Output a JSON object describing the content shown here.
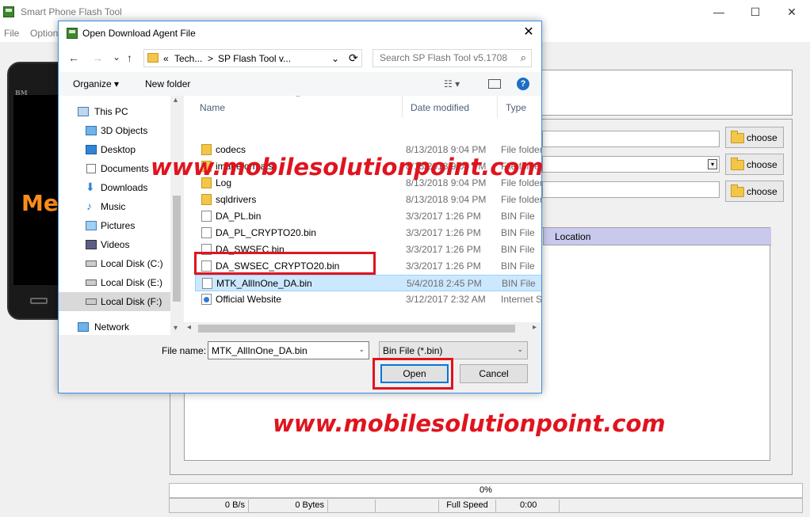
{
  "main": {
    "title": "Smart Phone Flash Tool",
    "window_controls": [
      "—",
      "☐",
      "✕"
    ],
    "menu": [
      "File",
      "Option"
    ],
    "phone_brand": "BM",
    "phone_logo": "Me",
    "choose_label": "choose",
    "table_header_location": "Location",
    "status": {
      "progress": "0%",
      "speed": "0 B/s",
      "bytes": "0 Bytes",
      "mode": "Full Speed",
      "time": "0:00"
    }
  },
  "watermark": "www.mobilesolutionpoint.com",
  "dialog": {
    "title": "Open Download Agent File",
    "close_glyph": "✕",
    "address": {
      "prefix": "«",
      "seg1": "Tech...",
      "sep": ">",
      "seg2": "SP Flash Tool v...",
      "dropdown": "⌄",
      "refresh": "⟳"
    },
    "search": {
      "placeholder": "Search SP Flash Tool v5.1708"
    },
    "toolbar": {
      "organize": "Organize ▾",
      "new_folder": "New folder",
      "view_glyph": "☷ ▾",
      "help": "?"
    },
    "nav_glyphs": {
      "back": "←",
      "forward": "→",
      "recent": "⌄",
      "up": "↑"
    },
    "nav_items": [
      {
        "label": "This PC"
      },
      {
        "label": "3D Objects"
      },
      {
        "label": "Desktop"
      },
      {
        "label": "Documents"
      },
      {
        "label": "Downloads"
      },
      {
        "label": "Music"
      },
      {
        "label": "Pictures"
      },
      {
        "label": "Videos"
      },
      {
        "label": "Local Disk (C:)"
      },
      {
        "label": "Local Disk (E:)"
      },
      {
        "label": "Local Disk (F:)",
        "selected": true
      },
      {
        "label": "Network"
      }
    ],
    "columns": {
      "name": "Name",
      "date": "Date modified",
      "type": "Type"
    },
    "files": [
      {
        "name": "codecs",
        "date": "8/13/2018 9:04 PM",
        "type": "File folder",
        "kind": "folder"
      },
      {
        "name": "imageformats",
        "date": "8/13/2018 9:04 PM",
        "type": "File folder",
        "kind": "folder"
      },
      {
        "name": "Log",
        "date": "8/13/2018 9:04 PM",
        "type": "File folder",
        "kind": "folder"
      },
      {
        "name": "sqldrivers",
        "date": "8/13/2018 9:04 PM",
        "type": "File folder",
        "kind": "folder"
      },
      {
        "name": "DA_PL.bin",
        "date": "3/3/2017 1:26 PM",
        "type": "BIN File",
        "kind": "file"
      },
      {
        "name": "DA_PL_CRYPTO20.bin",
        "date": "3/3/2017 1:26 PM",
        "type": "BIN File",
        "kind": "file"
      },
      {
        "name": "DA_SWSEC.bin",
        "date": "3/3/2017 1:26 PM",
        "type": "BIN File",
        "kind": "file"
      },
      {
        "name": "DA_SWSEC_CRYPTO20.bin",
        "date": "3/3/2017 1:26 PM",
        "type": "BIN File",
        "kind": "file"
      },
      {
        "name": "MTK_AllInOne_DA.bin",
        "date": "5/4/2018 2:45 PM",
        "type": "BIN File",
        "kind": "file",
        "selected": true
      },
      {
        "name": "Official Website",
        "date": "3/12/2017 2:32 AM",
        "type": "Internet S",
        "kind": "web"
      }
    ],
    "scroll_glyphs": {
      "left": "◂",
      "right": "▸",
      "up": "▴",
      "down": "▾"
    },
    "file_name_label": "File name:",
    "file_name_value": "MTK_AllInOne_DA.bin",
    "filter_value": "Bin File (*.bin)",
    "filter_options": [
      "Bin File (*.bin)"
    ],
    "dd_arrow": "⌄",
    "open_label": "Open",
    "cancel_label": "Cancel"
  },
  "colors": {
    "accent": "#0078d7",
    "highlight_box": "#e0141e",
    "watermark": "#e0141e",
    "selection": "#cce8ff"
  }
}
